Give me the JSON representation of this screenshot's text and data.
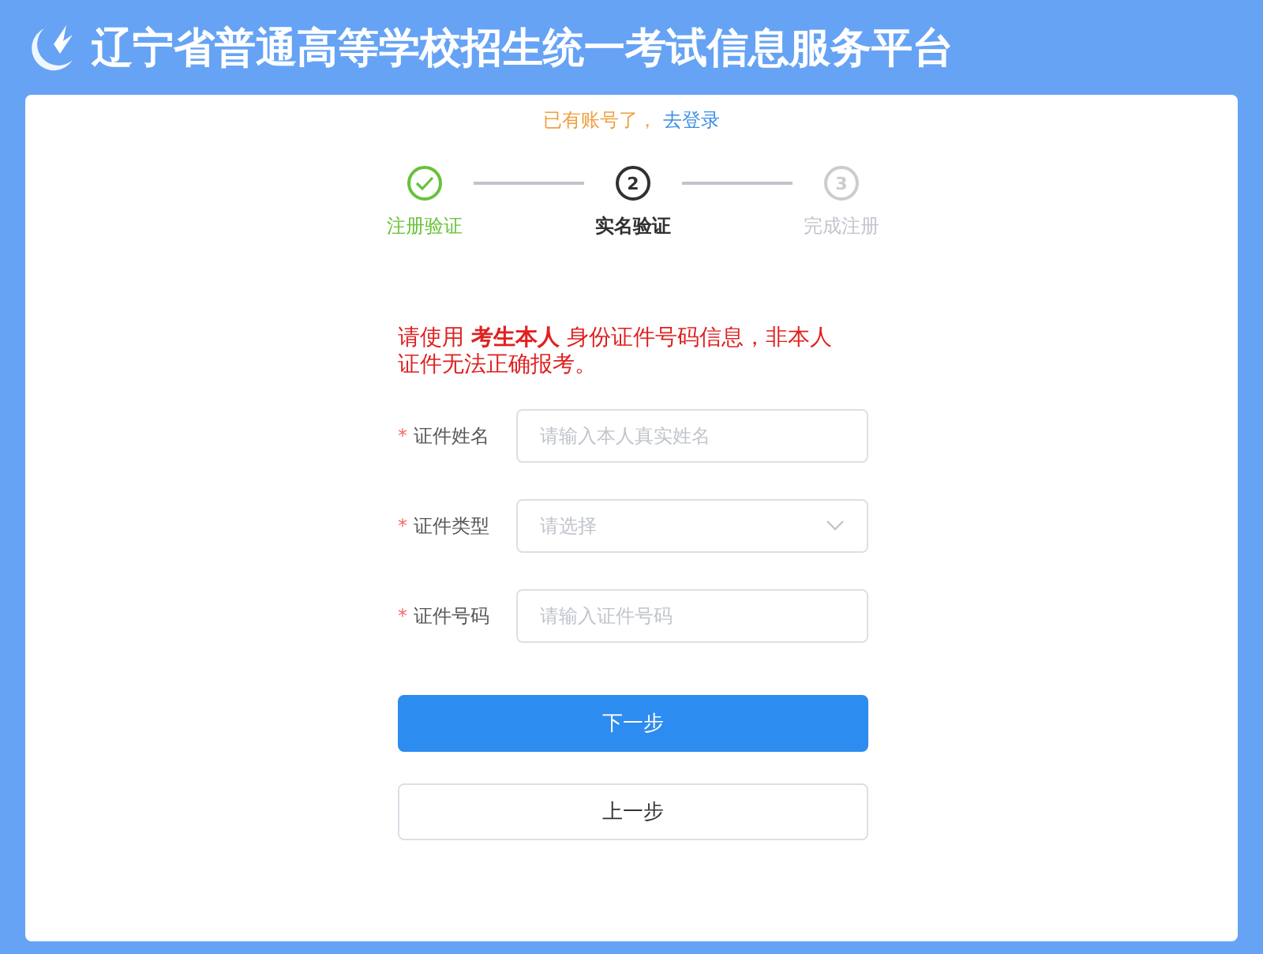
{
  "header": {
    "title": "辽宁省普通高等学校招生统一考试信息服务平台"
  },
  "login_prompt": {
    "text": "已有账号了，",
    "link": "去登录"
  },
  "steps": [
    {
      "label": "注册验证",
      "completed": true,
      "selected": false
    },
    {
      "number": "2",
      "label": "实名验证",
      "completed": false,
      "selected": true
    },
    {
      "number": "3",
      "label": "完成注册",
      "completed": false,
      "selected": false
    }
  ],
  "notice": "请使用 **考生本人** 身份证件号码信息，非本人证件无法正确报考。",
  "fields": [
    {
      "kind": "text",
      "required_mark": "*",
      "label": "证件姓名",
      "placeholder": "请输入本人真实姓名"
    },
    {
      "kind": "select",
      "required_mark": "*",
      "label": "证件类型",
      "placeholder": "请选择"
    },
    {
      "kind": "text",
      "required_mark": "*",
      "label": "证件号码",
      "placeholder": "请输入证件号码"
    }
  ],
  "buttons": [
    {
      "label": "下一步",
      "primary": true
    },
    {
      "label": "上一步",
      "primary": false
    }
  ]
}
